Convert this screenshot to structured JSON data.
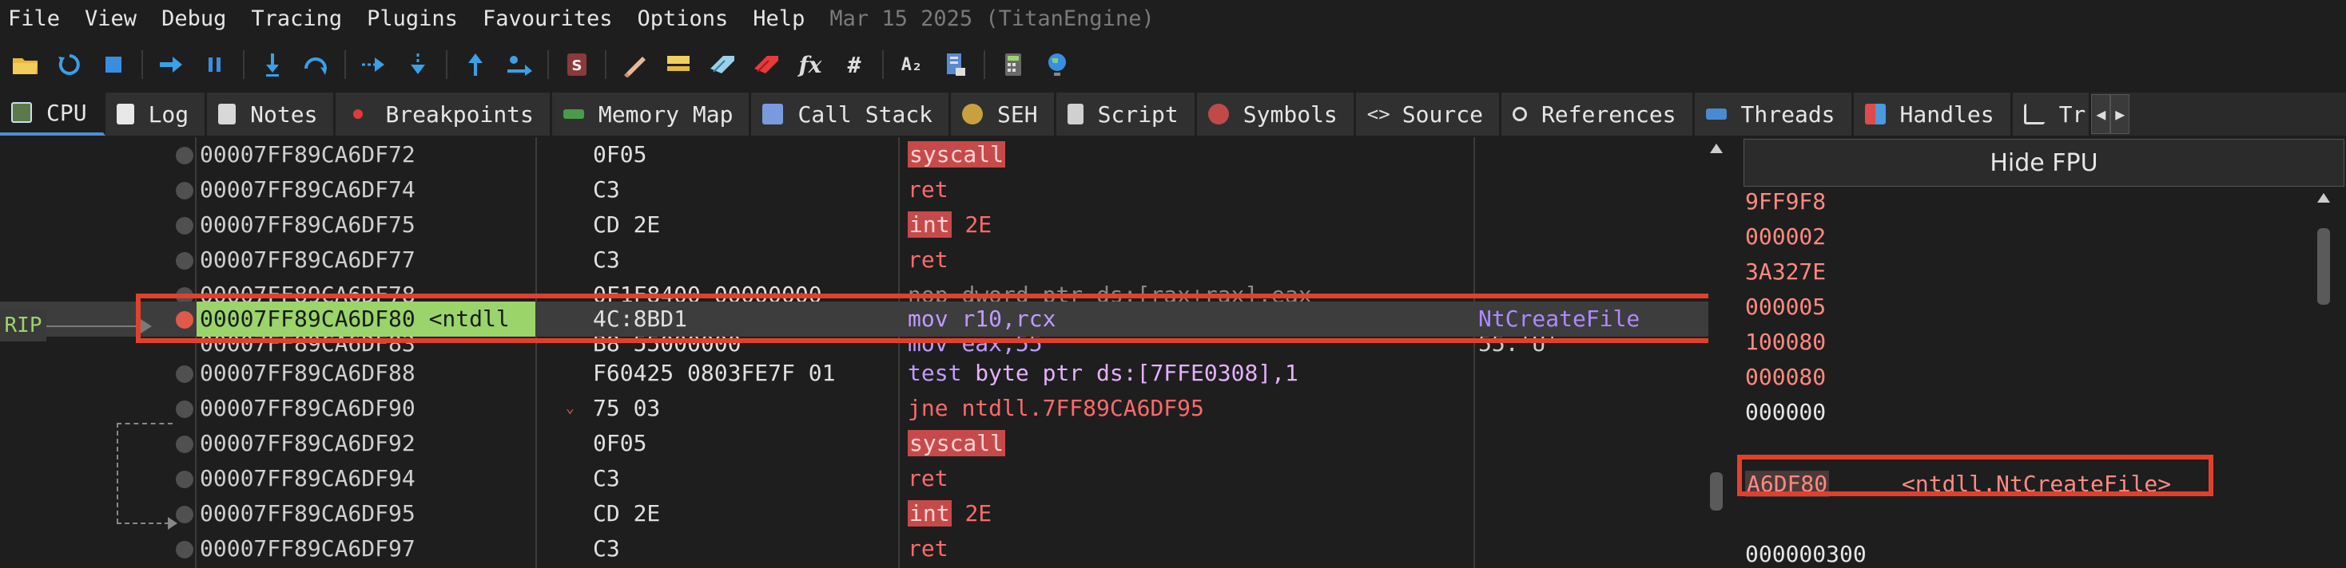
{
  "menu": {
    "items": [
      "File",
      "View",
      "Debug",
      "Tracing",
      "Plugins",
      "Favourites",
      "Options",
      "Help"
    ],
    "build": "Mar 15 2025 (TitanEngine)"
  },
  "toolbar": {
    "icons": [
      "open-icon",
      "restart-icon",
      "stop-icon",
      "run-icon",
      "pause-icon",
      "step-into-icon",
      "step-over-icon",
      "trace-into-icon",
      "trace-over-icon",
      "execute-till-return-icon",
      "run-to-user-code-icon",
      "scylla-icon",
      "patch-icon",
      "comment-icon",
      "label-icon",
      "bookmark-icon",
      "function-icon",
      "hash-icon",
      "strings-icon",
      "calls-icon",
      "calculator-icon",
      "globe-icon"
    ],
    "fx_label": "fx",
    "hash_label": "#",
    "strings_label": "A₂"
  },
  "tabs": [
    {
      "label": "CPU",
      "icon": "cpu-icon",
      "active": true
    },
    {
      "label": "Log",
      "icon": "log-icon",
      "active": false
    },
    {
      "label": "Notes",
      "icon": "notes-icon",
      "active": false
    },
    {
      "label": "Breakpoints",
      "icon": "breakpoint-dot-icon",
      "active": false
    },
    {
      "label": "Memory Map",
      "icon": "memory-map-icon",
      "active": false
    },
    {
      "label": "Call Stack",
      "icon": "call-stack-icon",
      "active": false
    },
    {
      "label": "SEH",
      "icon": "seh-icon",
      "active": false
    },
    {
      "label": "Script",
      "icon": "script-icon",
      "active": false
    },
    {
      "label": "Symbols",
      "icon": "symbols-icon",
      "active": false
    },
    {
      "label": "Source",
      "icon": "source-icon",
      "active": false
    },
    {
      "label": "References",
      "icon": "references-icon",
      "active": false
    },
    {
      "label": "Threads",
      "icon": "threads-icon",
      "active": false
    },
    {
      "label": "Handles",
      "icon": "handles-icon",
      "active": false
    },
    {
      "label": "Tr",
      "icon": "trace-icon",
      "active": false
    }
  ],
  "disasm": {
    "rip_label": "RIP",
    "rows": [
      {
        "addr": "00007FF89CA6DF72",
        "bytes": "0F05",
        "mnemonic": "syscall",
        "operands": "",
        "comment": ""
      },
      {
        "addr": "00007FF89CA6DF74",
        "bytes": "C3",
        "mnemonic": "ret",
        "operands": "",
        "comment": ""
      },
      {
        "addr": "00007FF89CA6DF75",
        "bytes": "CD 2E",
        "mnemonic": "int",
        "operands": "2E",
        "comment": ""
      },
      {
        "addr": "00007FF89CA6DF77",
        "bytes": "C3",
        "mnemonic": "ret",
        "operands": "",
        "comment": ""
      },
      {
        "addr": "00007FF89CA6DF78",
        "bytes": "0F1F8400 00000000",
        "mnemonic": "nop",
        "operands": "dword ptr ds:[rax+rax],eax",
        "comment": ""
      },
      {
        "addr": "00007FF89CA6DF80 <ntdll",
        "bytes": "4C:8BD1",
        "mnemonic": "mov",
        "operands": "r10,rcx",
        "comment": "NtCreateFile"
      },
      {
        "addr": "00007FF89CA6DF83",
        "bytes": "B8 55000000",
        "mnemonic": "mov",
        "operands": "eax,55",
        "comment": "55:'U'"
      },
      {
        "addr": "00007FF89CA6DF88",
        "bytes": "F60425 0803FE7F 01",
        "mnemonic": "test",
        "operands": "byte ptr ds:[7FFE0308],1",
        "comment": ""
      },
      {
        "addr": "00007FF89CA6DF90",
        "bytes": "75 03",
        "mnemonic": "jne",
        "operands": "ntdll.7FF89CA6DF95",
        "comment": ""
      },
      {
        "addr": "00007FF89CA6DF92",
        "bytes": "0F05",
        "mnemonic": "syscall",
        "operands": "",
        "comment": ""
      },
      {
        "addr": "00007FF89CA6DF94",
        "bytes": "C3",
        "mnemonic": "ret",
        "operands": "",
        "comment": ""
      },
      {
        "addr": "00007FF89CA6DF95",
        "bytes": "CD 2E",
        "mnemonic": "int",
        "operands": "2E",
        "comment": ""
      },
      {
        "addr": "00007FF89CA6DF97",
        "bytes": "C3",
        "mnemonic": "ret",
        "operands": "",
        "comment": ""
      }
    ],
    "current_row_index": 5
  },
  "registers": {
    "hide_fpu_label": "Hide FPU",
    "values": [
      "9FF9F8",
      "000002",
      "3A327E",
      "000005",
      "100080",
      "000080",
      "000000"
    ],
    "rip_value": "A6DF80",
    "rip_symbol": "<ntdll.NtCreateFile>",
    "last_value": "000000300"
  },
  "colors": {
    "background": "#1e1e1e",
    "current_address_bg": "#9ad46a",
    "syscall_bg": "#c74a4a",
    "register_text": "#ff8a80",
    "highlight_box": "#e2402c",
    "active_tab_accent": "#4a8fd6"
  }
}
